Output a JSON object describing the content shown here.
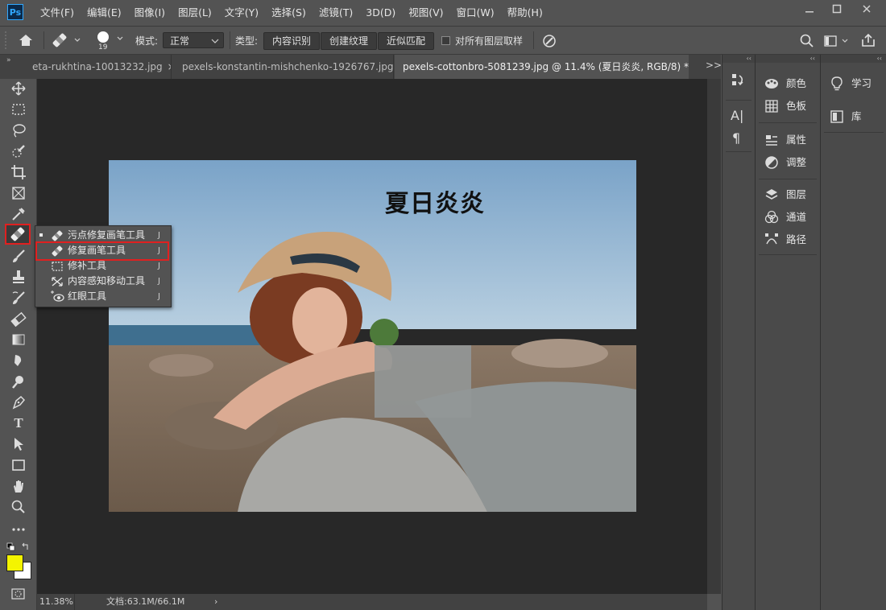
{
  "app": {
    "logo": "Ps"
  },
  "menubar": {
    "items": [
      "文件(F)",
      "编辑(E)",
      "图像(I)",
      "图层(L)",
      "文字(Y)",
      "选择(S)",
      "滤镜(T)",
      "3D(D)",
      "视图(V)",
      "窗口(W)",
      "帮助(H)"
    ]
  },
  "options": {
    "brush_size": "19",
    "mode_label": "模式:",
    "mode_value": "正常",
    "type_label": "类型:",
    "type_buttons": [
      "内容识别",
      "创建纹理",
      "近似匹配"
    ],
    "sample_all_label": "对所有图层取样"
  },
  "tabs": [
    {
      "label": "eta-rukhtina-10013232.jpg",
      "close": "×"
    },
    {
      "label": "pexels-konstantin-mishchenko-1926767.jpg",
      "close": "×"
    },
    {
      "label": "pexels-cottonbro-5081239.jpg @ 11.4% (夏日炎炎, RGB/8) *",
      "close": "×"
    }
  ],
  "tabs_overflow": ">>",
  "canvas": {
    "overlay_text": "夏日炎炎"
  },
  "flyout": {
    "items": [
      {
        "label": "污点修复画笔工具",
        "key": "J",
        "icon": "spot-healing-brush-icon"
      },
      {
        "label": "修复画笔工具",
        "key": "J",
        "icon": "healing-brush-icon"
      },
      {
        "label": "修补工具",
        "key": "J",
        "icon": "patch-icon"
      },
      {
        "label": "内容感知移动工具",
        "key": "J",
        "icon": "content-aware-move-icon"
      },
      {
        "label": "红眼工具",
        "key": "J",
        "icon": "red-eye-icon"
      }
    ]
  },
  "status": {
    "zoom": "11.38%",
    "doc": "文档:63.1M/66.1M",
    "arrow": "›"
  },
  "panels": {
    "col2": [
      {
        "label": "颜色",
        "icon": "palette-icon"
      },
      {
        "label": "色板",
        "icon": "swatches-icon"
      },
      {
        "label": "属性",
        "icon": "properties-icon"
      },
      {
        "label": "调整",
        "icon": "adjustments-icon"
      },
      {
        "label": "图层",
        "icon": "layers-icon"
      },
      {
        "label": "通道",
        "icon": "channels-icon"
      },
      {
        "label": "路径",
        "icon": "paths-icon"
      }
    ],
    "col3": [
      {
        "label": "学习",
        "icon": "learn-icon"
      },
      {
        "label": "库",
        "icon": "libraries-icon"
      }
    ]
  },
  "colors": {
    "foreground": "#f4f400",
    "background": "#ffffff",
    "highlight": "#e02020"
  }
}
